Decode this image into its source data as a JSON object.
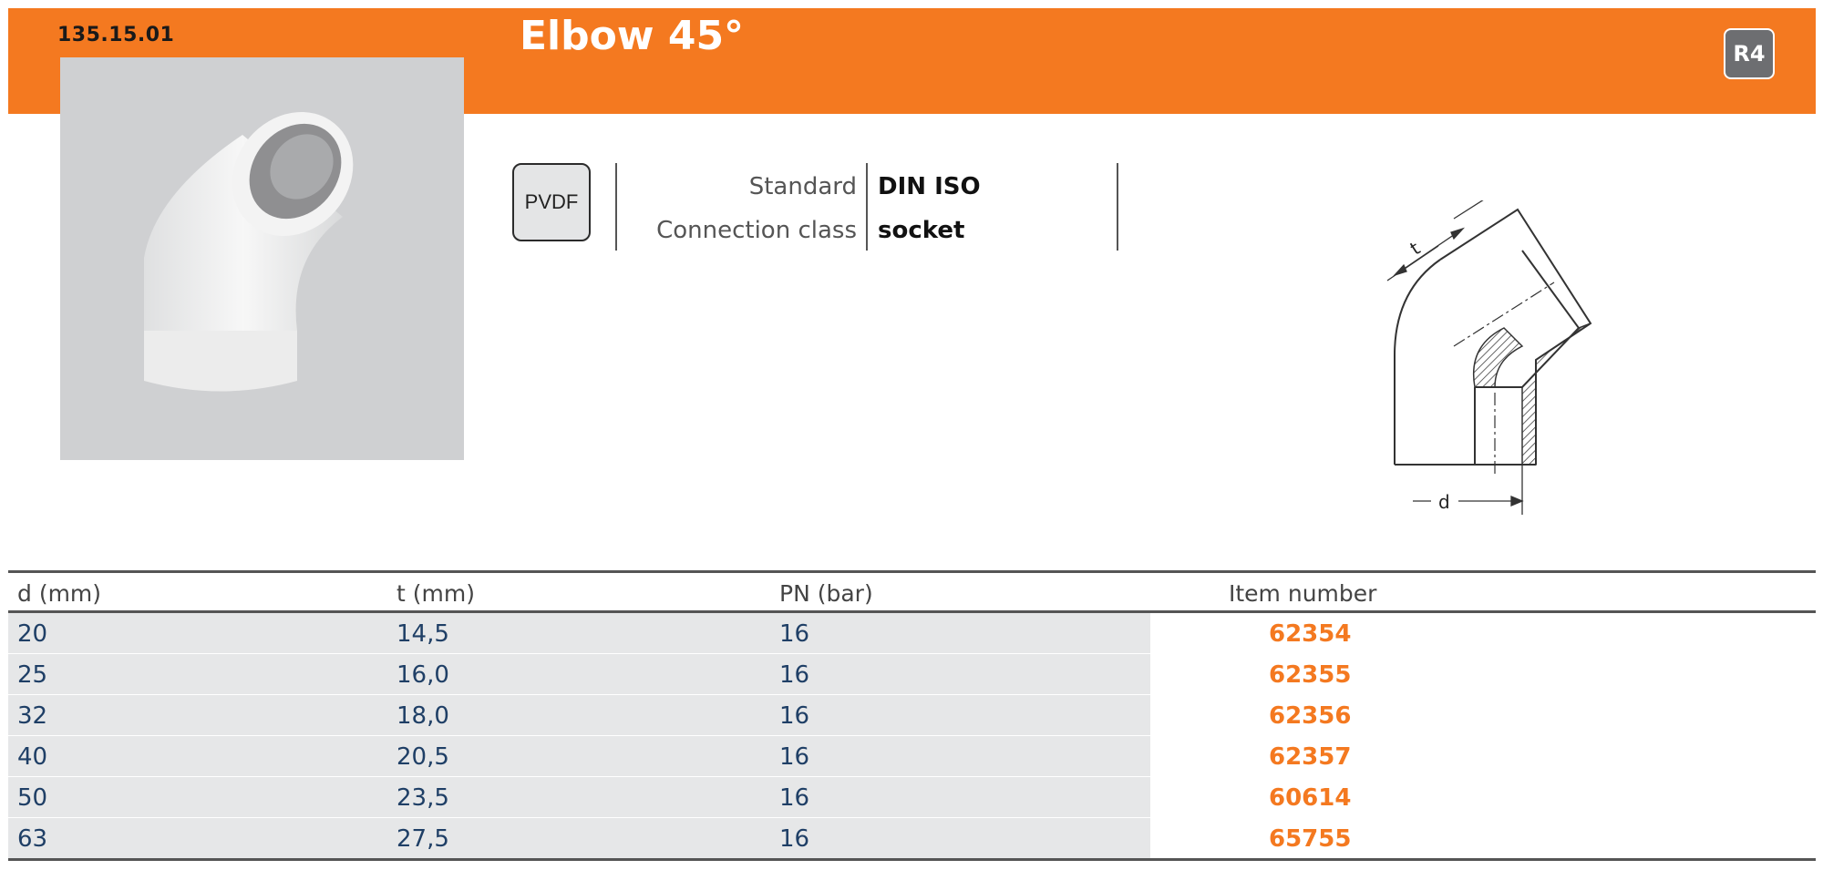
{
  "header": {
    "code": "135.15.01",
    "title": "Elbow 45°",
    "badge": "R4"
  },
  "material": "PVDF",
  "specs": [
    {
      "label": "Standard",
      "value": "DIN ISO"
    },
    {
      "label": "Connection class",
      "value": "socket"
    }
  ],
  "drawing": {
    "t_label": "t",
    "d_label": "d"
  },
  "table": {
    "columns": [
      "d (mm)",
      "t (mm)",
      "PN (bar)",
      "Item number"
    ],
    "rows": [
      [
        "20",
        "14,5",
        "16",
        "62354"
      ],
      [
        "25",
        "16,0",
        "16",
        "62355"
      ],
      [
        "32",
        "18,0",
        "16",
        "62356"
      ],
      [
        "40",
        "20,5",
        "16",
        "62357"
      ],
      [
        "50",
        "23,5",
        "16",
        "60614"
      ],
      [
        "63",
        "27,5",
        "16",
        "65755"
      ]
    ]
  },
  "colors": {
    "accent": "#f47920",
    "value_blue": "#1f3f66",
    "row_shade": "#e6e7e8"
  }
}
